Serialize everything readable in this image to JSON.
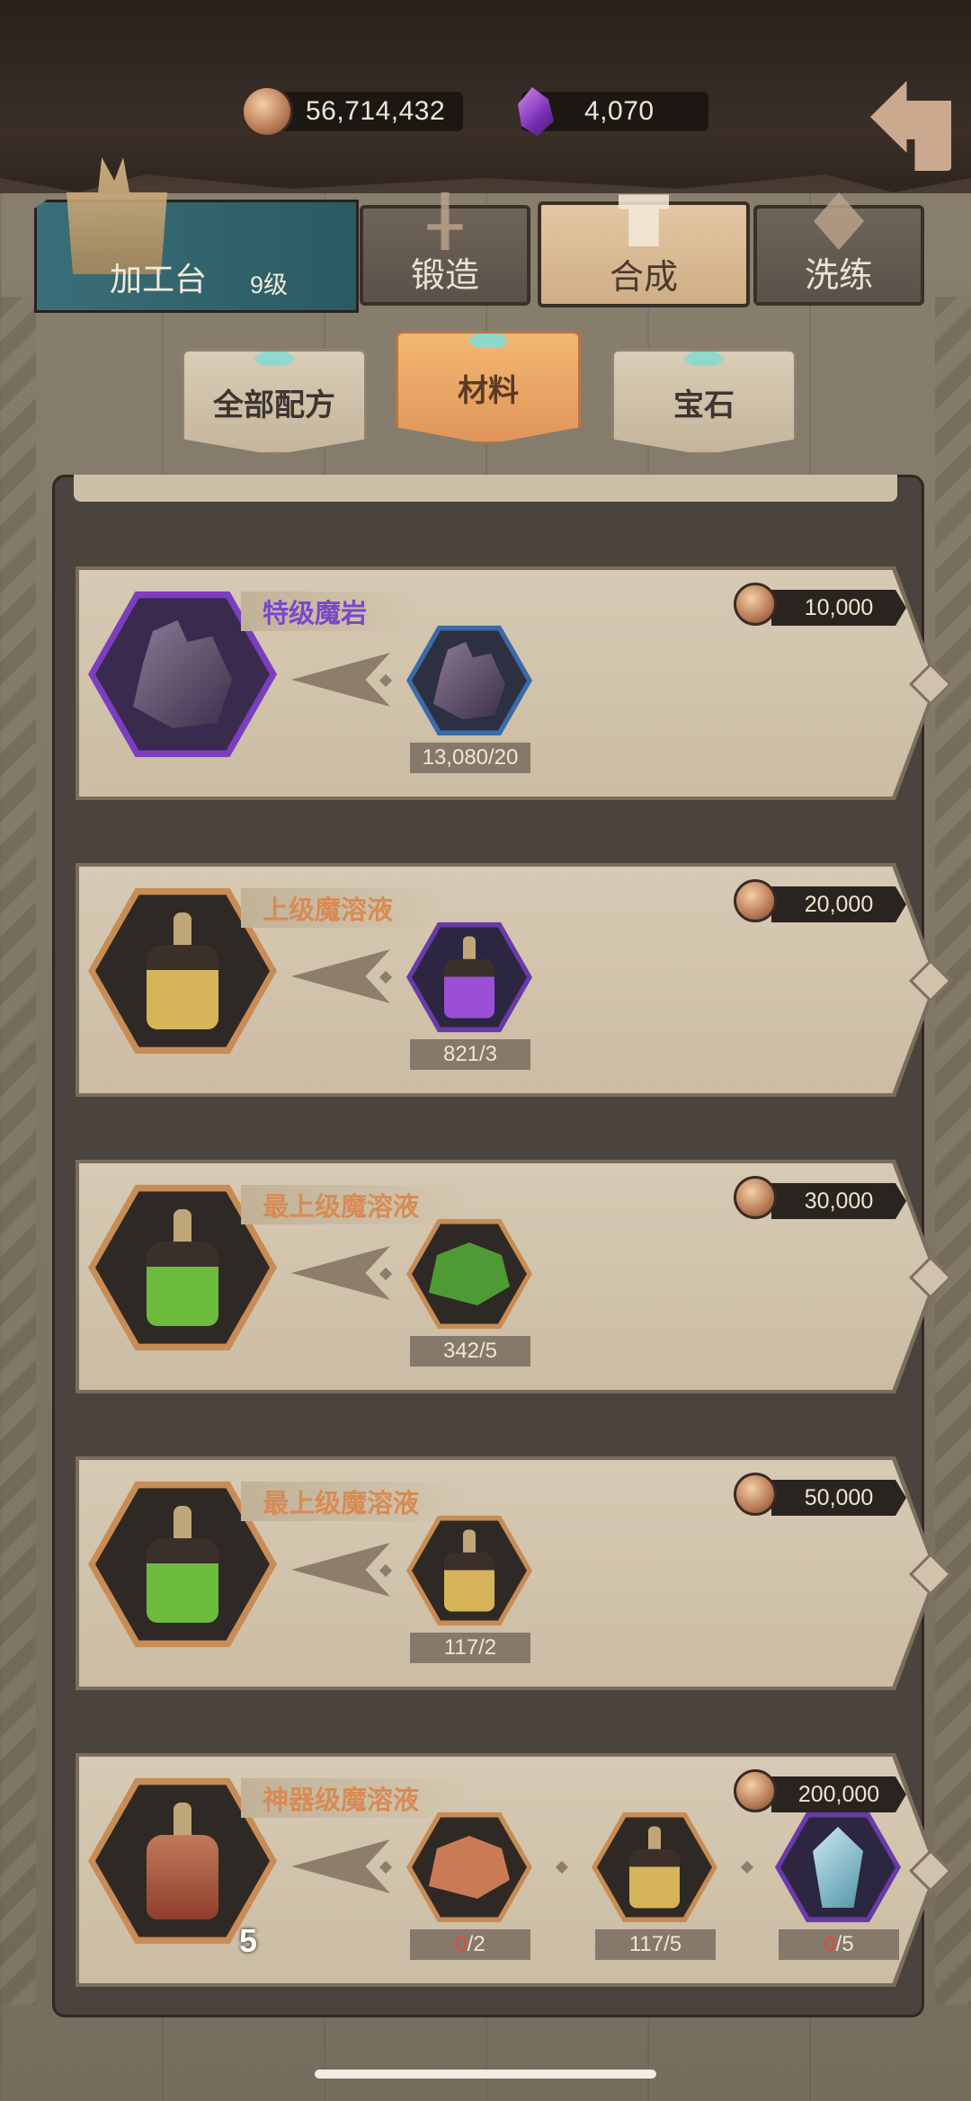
{
  "currency": {
    "coins": "56,714,432",
    "gems": "4,070"
  },
  "workbench": {
    "label": "加工台",
    "level": "9级"
  },
  "main_tabs": [
    {
      "label": "锻造",
      "icon": "sword-icon",
      "active": false
    },
    {
      "label": "合成",
      "icon": "craft-icon",
      "active": true
    },
    {
      "label": "洗练",
      "icon": "refine-icon",
      "active": false
    }
  ],
  "sub_tabs": [
    {
      "label": "全部配方",
      "active": false
    },
    {
      "label": "材料",
      "active": true
    },
    {
      "label": "宝石",
      "active": false
    }
  ],
  "recipes": [
    {
      "name": "特级魔岩",
      "name_color": "#7a48c9",
      "price": "10,000",
      "result_icon": "magic-rock-icon",
      "ingredients": [
        {
          "icon": "magic-rock-icon",
          "count": "13,080/20"
        }
      ]
    },
    {
      "name": "上级魔溶液",
      "name_color": "#d88b53",
      "price": "20,000",
      "result_icon": "yellow-potion-icon",
      "ingredients": [
        {
          "icon": "purple-potion-icon",
          "count": "821/3"
        }
      ]
    },
    {
      "name": "最上级魔溶液",
      "name_color": "#d88b53",
      "price": "30,000",
      "result_icon": "green-potion-icon",
      "ingredients": [
        {
          "icon": "green-ore-icon",
          "count": "342/5"
        }
      ]
    },
    {
      "name": "最上级魔溶液",
      "name_color": "#d88b53",
      "price": "50,000",
      "result_icon": "green-potion-icon",
      "ingredients": [
        {
          "icon": "yellow-potion-icon",
          "count": "117/2"
        }
      ]
    },
    {
      "name": "神器级魔溶液",
      "name_color": "#d88b53",
      "price": "200,000",
      "result_icon": "red-potion-icon",
      "result_qty": "5",
      "ingredients": [
        {
          "icon": "copper-ore-icon",
          "have": "0",
          "need": "/2"
        },
        {
          "icon": "yellow-potion-icon",
          "count": "117/5"
        },
        {
          "icon": "ice-crystal-icon",
          "have": "0",
          "need": "/5"
        }
      ]
    }
  ]
}
